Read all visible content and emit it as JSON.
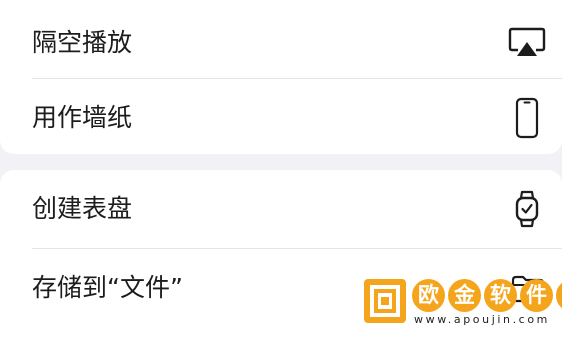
{
  "share_sheet": {
    "groups": [
      {
        "rows": [
          {
            "label": "隔空播放",
            "icon": "airplay-icon"
          },
          {
            "label": "用作墙纸",
            "icon": "iphone-icon"
          }
        ]
      },
      {
        "rows": [
          {
            "label": "创建表盘",
            "icon": "watch-icon"
          },
          {
            "label": "存储到“文件”",
            "icon": "folder-icon"
          }
        ]
      }
    ]
  },
  "watermark": {
    "chars": [
      "欧",
      "金",
      "软",
      "件",
      "园"
    ],
    "url": "www.apoujin.com"
  }
}
